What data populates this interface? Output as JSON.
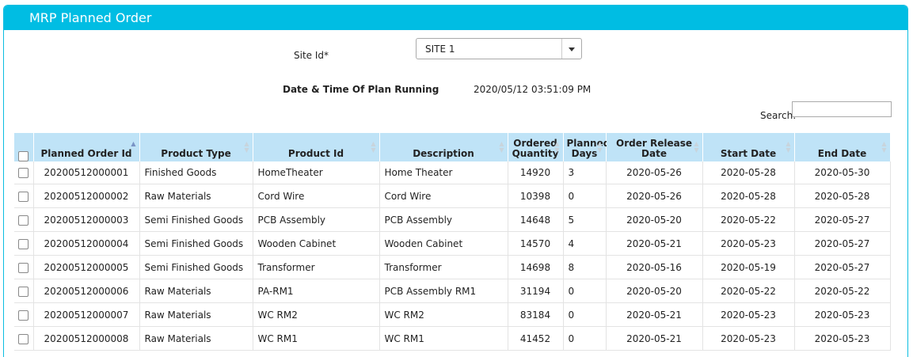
{
  "panel": {
    "title": "MRP Planned Order"
  },
  "form": {
    "site_label": "Site Id*",
    "site_value": "SITE 1",
    "plan_time_label": "Date & Time Of Plan Running",
    "plan_time_value": "2020/05/12 03:51:09 PM",
    "search_label": "Search:",
    "search_value": ""
  },
  "table": {
    "columns": [
      "Planned Order Id",
      "Product Type",
      "Product Id",
      "Description",
      "Ordered Quantity",
      "Planned Days",
      "Order Release Date",
      "Start Date",
      "End Date"
    ],
    "rows": [
      [
        "20200512000001",
        "Finished Goods",
        "HomeTheater",
        "Home Theater",
        "14920",
        "3",
        "2020-05-26",
        "2020-05-28",
        "2020-05-30"
      ],
      [
        "20200512000002",
        "Raw Materials",
        "Cord Wire",
        "Cord Wire",
        "10398",
        "0",
        "2020-05-26",
        "2020-05-28",
        "2020-05-28"
      ],
      [
        "20200512000003",
        "Semi Finished Goods",
        "PCB Assembly",
        "PCB Assembly",
        "14648",
        "5",
        "2020-05-20",
        "2020-05-22",
        "2020-05-27"
      ],
      [
        "20200512000004",
        "Semi Finished Goods",
        "Wooden Cabinet",
        "Wooden Cabinet",
        "14570",
        "4",
        "2020-05-21",
        "2020-05-23",
        "2020-05-27"
      ],
      [
        "20200512000005",
        "Semi Finished Goods",
        "Transformer",
        "Transformer",
        "14698",
        "8",
        "2020-05-16",
        "2020-05-19",
        "2020-05-27"
      ],
      [
        "20200512000006",
        "Raw Materials",
        "PA-RM1",
        "PCB Assembly RM1",
        "31194",
        "0",
        "2020-05-20",
        "2020-05-22",
        "2020-05-22"
      ],
      [
        "20200512000007",
        "Raw Materials",
        "WC RM2",
        "WC RM2",
        "83184",
        "0",
        "2020-05-21",
        "2020-05-23",
        "2020-05-23"
      ],
      [
        "20200512000008",
        "Raw Materials",
        "WC RM1",
        "WC RM1",
        "41452",
        "0",
        "2020-05-21",
        "2020-05-23",
        "2020-05-23"
      ]
    ]
  }
}
